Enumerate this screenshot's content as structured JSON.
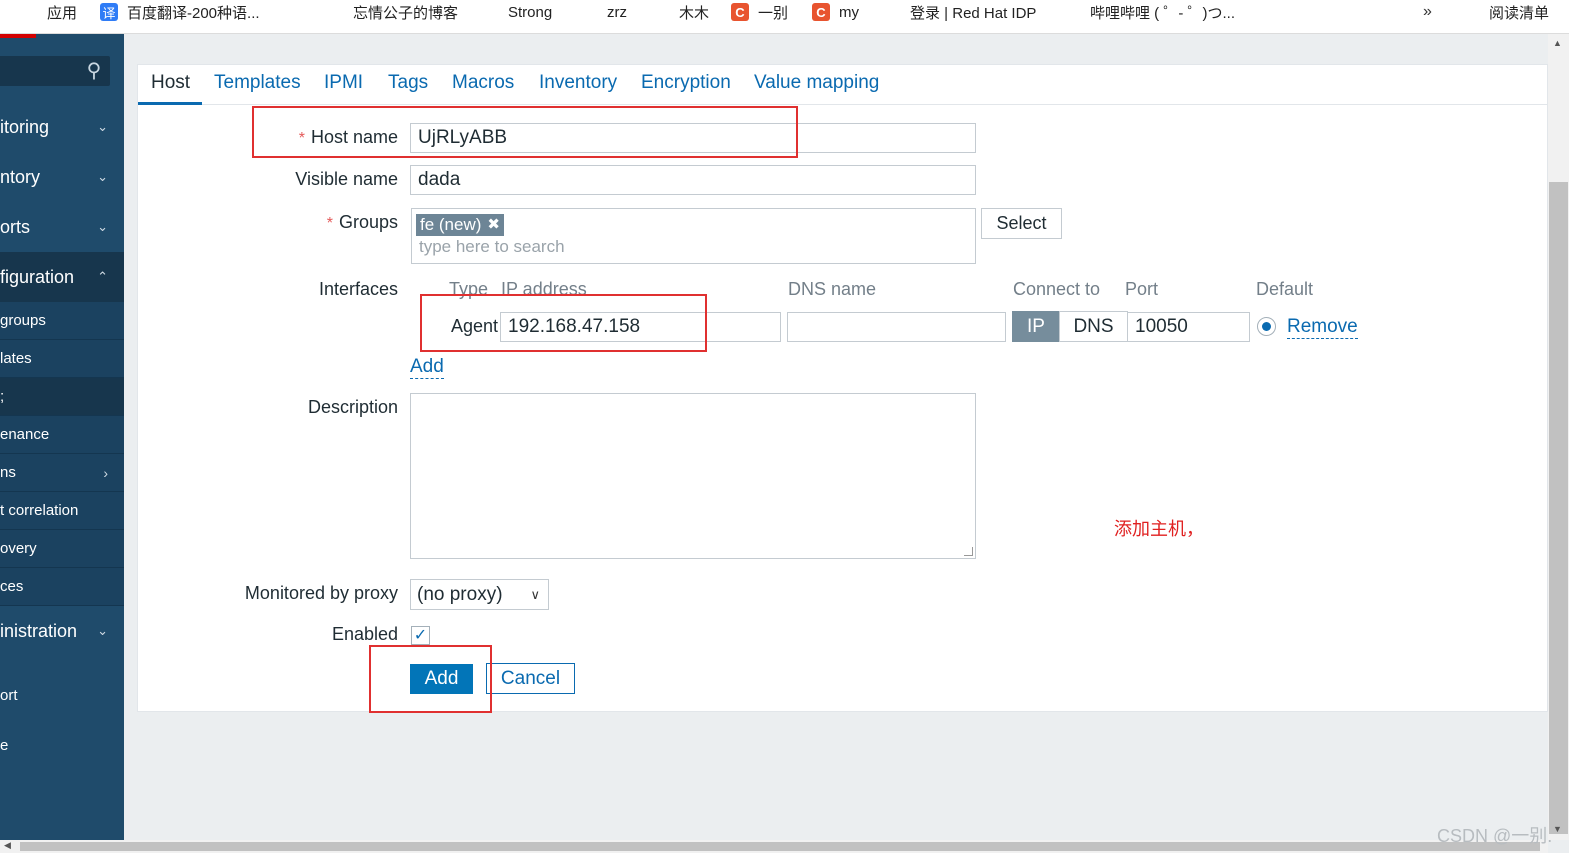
{
  "bookmarks": [
    {
      "label": "应用",
      "icon": "apps-grid-icon"
    },
    {
      "label": "百度翻译-200种语...",
      "icon": "translate-icon"
    },
    {
      "label": "",
      "icon": "globe-icon"
    },
    {
      "label": "忘情公子的博客",
      "icon": "globe-icon"
    },
    {
      "label": "Strong",
      "icon": "strong-icon"
    },
    {
      "label": "zrz",
      "icon": "globe-icon"
    },
    {
      "label": "木木",
      "icon": "figure-icon"
    },
    {
      "label": "一别",
      "icon": "csdn-icon"
    },
    {
      "label": "my",
      "icon": "csdn-icon"
    },
    {
      "label": "登录 | Red Hat IDP",
      "icon": "redhat-icon"
    },
    {
      "label": "哔哩哔哩 ( ゜- ゜)つ...",
      "icon": "bilibili-icon"
    }
  ],
  "bookmarks_more": "»",
  "reading_list": "阅读清单",
  "sidebar": {
    "sections": [
      "itoring",
      "ntory",
      "orts",
      "figuration"
    ],
    "config_items": [
      "groups",
      "lates",
      ";",
      "enance",
      "ns",
      "t correlation",
      "overy",
      "ces"
    ],
    "admin": "inistration",
    "plain_items": [
      "ort",
      "e"
    ]
  },
  "tabs": [
    "Host",
    "Templates",
    "IPMI",
    "Tags",
    "Macros",
    "Inventory",
    "Encryption",
    "Value mapping"
  ],
  "form": {
    "host_name_label": "Host name",
    "host_name_value": "UjRLyABB",
    "visible_name_label": "Visible name",
    "visible_name_value": "dada",
    "groups_label": "Groups",
    "group_chip": "fe (new)",
    "groups_placeholder": "type here to search",
    "select_button": "Select",
    "interfaces_label": "Interfaces",
    "columns": {
      "type": "Type",
      "ip": "IP address",
      "dns": "DNS name",
      "connect": "Connect to",
      "port": "Port",
      "default": "Default"
    },
    "agent_label": "Agent",
    "ip_value": "192.168.47.158",
    "dns_value": "",
    "connect_ip": "IP",
    "connect_dns": "DNS",
    "port_value": "10050",
    "remove_link": "Remove",
    "add_link": "Add",
    "description_label": "Description",
    "proxy_label": "Monitored by proxy",
    "proxy_value": "(no proxy)",
    "enabled_label": "Enabled",
    "add_button": "Add",
    "cancel_button": "Cancel"
  },
  "annotation_note": "添加主机，",
  "watermark": "CSDN @一别."
}
